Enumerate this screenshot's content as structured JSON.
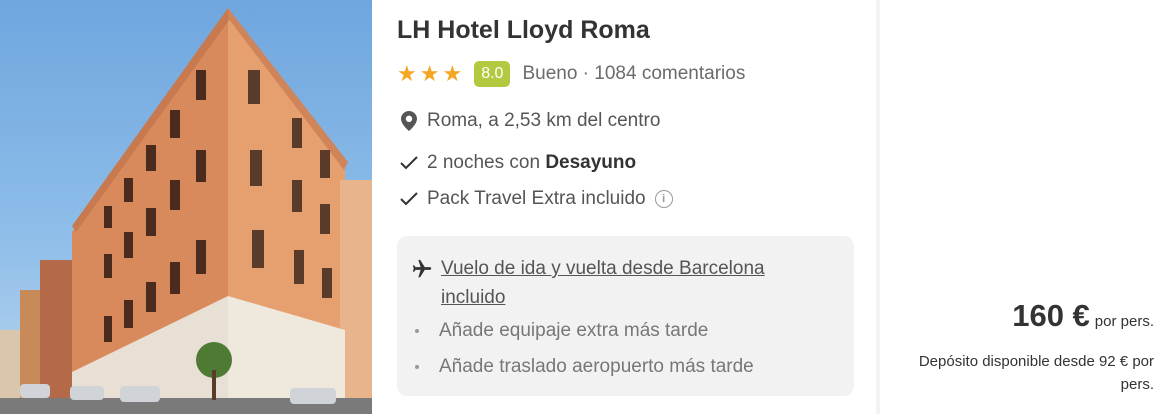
{
  "hotel": {
    "name": "LH Hotel Lloyd Roma",
    "stars": 3,
    "score": "8.0",
    "rating_label": "Bueno · 1084 comentarios",
    "location": "Roma, a 2,53 km del centro",
    "nights_prefix": "2 noches con ",
    "nights_bold": "Desayuno",
    "pack": "Pack Travel Extra incluido"
  },
  "flight": {
    "link_text": "Vuelo de ida y vuelta desde Barcelona incluido",
    "extras": [
      "Añade equipaje extra más tarde",
      "Añade traslado aeropuerto más tarde"
    ]
  },
  "price": {
    "amount": "160 €",
    "unit": "por pers.",
    "deposit": "Depósito disponible desde 92 € por pers."
  },
  "colors": {
    "star": "#f5a623",
    "score_badge": "#b3c93f"
  },
  "icons": [
    "star-icon",
    "location-pin-icon",
    "check-icon",
    "info-icon",
    "airplane-icon"
  ]
}
